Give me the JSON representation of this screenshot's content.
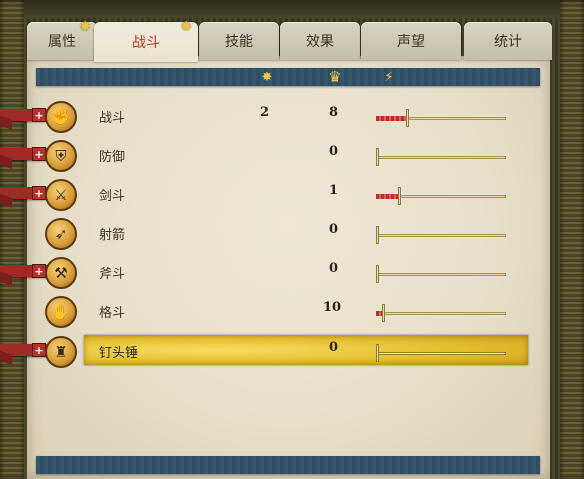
{
  "tabs": [
    {
      "label": "属性",
      "active": false,
      "star": true
    },
    {
      "label": "战斗",
      "active": true,
      "star": true
    },
    {
      "label": "技能",
      "active": false,
      "star": false
    },
    {
      "label": "效果",
      "active": false,
      "star": false
    },
    {
      "label": "声望",
      "active": false,
      "star": false
    },
    {
      "label": "统计",
      "active": false,
      "star": false
    }
  ],
  "header_icons": [
    {
      "name": "star-icon",
      "glyph": "✸"
    },
    {
      "name": "crown-icon",
      "glyph": "♛"
    },
    {
      "name": "rank-icon",
      "glyph": "⚡"
    }
  ],
  "skills": [
    {
      "label": "战斗",
      "points": "2",
      "level": "8",
      "progress": 0.24,
      "icon": "✊",
      "has_plus": true,
      "selected": false
    },
    {
      "label": "防御",
      "points": "",
      "level": "0",
      "progress": 0.0,
      "icon": "⛨",
      "has_plus": true,
      "selected": false
    },
    {
      "label": "剑斗",
      "points": "",
      "level": "1",
      "progress": 0.18,
      "icon": "⚔",
      "has_plus": true,
      "selected": false
    },
    {
      "label": "射箭",
      "points": "",
      "level": "0",
      "progress": 0.0,
      "icon": "➶",
      "has_plus": false,
      "selected": false
    },
    {
      "label": "斧斗",
      "points": "",
      "level": "0",
      "progress": 0.0,
      "icon": "⚒",
      "has_plus": true,
      "selected": false
    },
    {
      "label": "格斗",
      "points": "",
      "level": "10",
      "progress": 0.05,
      "icon": "✋",
      "has_plus": false,
      "selected": false
    },
    {
      "label": "钉头锤",
      "points": "",
      "level": "0",
      "progress": 0.0,
      "icon": "♜",
      "has_plus": true,
      "selected": true
    }
  ],
  "colors": {
    "active_tab_text": "#b23a2a",
    "header_bar": "#35566d",
    "highlight": "#e4bf2f",
    "ribbon": "#9e2a26"
  }
}
